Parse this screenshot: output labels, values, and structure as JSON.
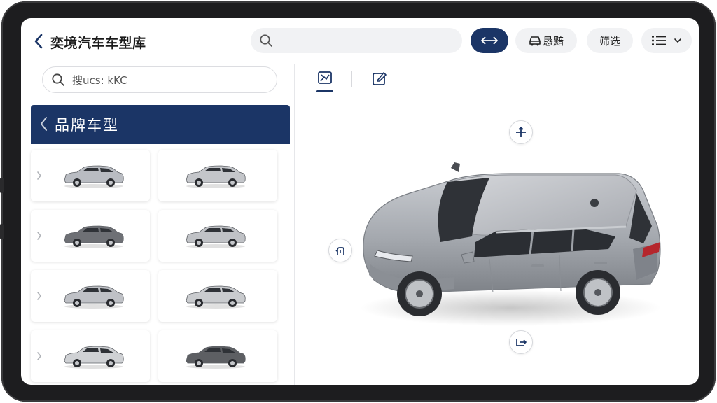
{
  "header": {
    "title": "奕境汽车车型库",
    "share_label": "恳黯",
    "filter_label": "筛选"
  },
  "sidebar": {
    "search_value": "搜ucs: kKC",
    "brand_header": "品牌车型",
    "cars": [
      {
        "color": "#b9bcc2"
      },
      {
        "color": "#c4c6ca"
      },
      {
        "color": "#6e7075"
      },
      {
        "color": "#c0c2c6"
      },
      {
        "color": "#bfc1c6"
      },
      {
        "color": "#c9cbce"
      },
      {
        "color": "#cfd1d4"
      },
      {
        "color": "#5d5f63"
      }
    ]
  },
  "viewer": {
    "car_color": "#a9acb2",
    "active_tab": "2d-view"
  },
  "colors": {
    "accent": "#1b3566",
    "background": "#ffffff",
    "bezel": "#1d1d1f"
  }
}
